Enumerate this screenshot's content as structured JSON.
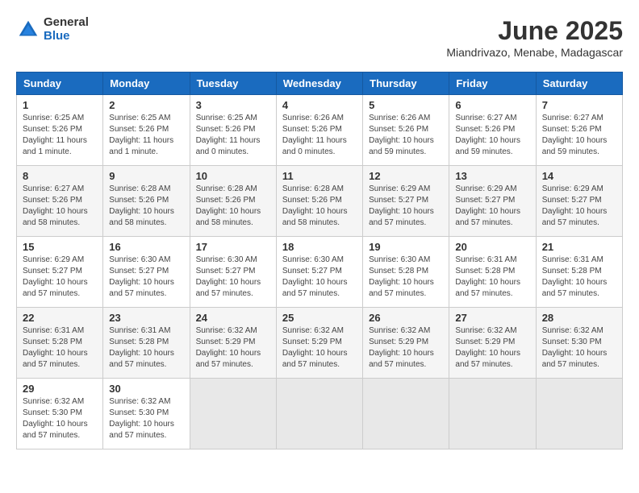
{
  "header": {
    "logo_general": "General",
    "logo_blue": "Blue",
    "month_title": "June 2025",
    "subtitle": "Miandrivazo, Menabe, Madagascar"
  },
  "days_of_week": [
    "Sunday",
    "Monday",
    "Tuesday",
    "Wednesday",
    "Thursday",
    "Friday",
    "Saturday"
  ],
  "weeks": [
    [
      {
        "day": 1,
        "info": "Sunrise: 6:25 AM\nSunset: 5:26 PM\nDaylight: 11 hours and 1 minute."
      },
      {
        "day": 2,
        "info": "Sunrise: 6:25 AM\nSunset: 5:26 PM\nDaylight: 11 hours and 1 minute."
      },
      {
        "day": 3,
        "info": "Sunrise: 6:25 AM\nSunset: 5:26 PM\nDaylight: 11 hours and 0 minutes."
      },
      {
        "day": 4,
        "info": "Sunrise: 6:26 AM\nSunset: 5:26 PM\nDaylight: 11 hours and 0 minutes."
      },
      {
        "day": 5,
        "info": "Sunrise: 6:26 AM\nSunset: 5:26 PM\nDaylight: 10 hours and 59 minutes."
      },
      {
        "day": 6,
        "info": "Sunrise: 6:27 AM\nSunset: 5:26 PM\nDaylight: 10 hours and 59 minutes."
      },
      {
        "day": 7,
        "info": "Sunrise: 6:27 AM\nSunset: 5:26 PM\nDaylight: 10 hours and 59 minutes."
      }
    ],
    [
      {
        "day": 8,
        "info": "Sunrise: 6:27 AM\nSunset: 5:26 PM\nDaylight: 10 hours and 58 minutes."
      },
      {
        "day": 9,
        "info": "Sunrise: 6:28 AM\nSunset: 5:26 PM\nDaylight: 10 hours and 58 minutes."
      },
      {
        "day": 10,
        "info": "Sunrise: 6:28 AM\nSunset: 5:26 PM\nDaylight: 10 hours and 58 minutes."
      },
      {
        "day": 11,
        "info": "Sunrise: 6:28 AM\nSunset: 5:26 PM\nDaylight: 10 hours and 58 minutes."
      },
      {
        "day": 12,
        "info": "Sunrise: 6:29 AM\nSunset: 5:27 PM\nDaylight: 10 hours and 57 minutes."
      },
      {
        "day": 13,
        "info": "Sunrise: 6:29 AM\nSunset: 5:27 PM\nDaylight: 10 hours and 57 minutes."
      },
      {
        "day": 14,
        "info": "Sunrise: 6:29 AM\nSunset: 5:27 PM\nDaylight: 10 hours and 57 minutes."
      }
    ],
    [
      {
        "day": 15,
        "info": "Sunrise: 6:29 AM\nSunset: 5:27 PM\nDaylight: 10 hours and 57 minutes."
      },
      {
        "day": 16,
        "info": "Sunrise: 6:30 AM\nSunset: 5:27 PM\nDaylight: 10 hours and 57 minutes."
      },
      {
        "day": 17,
        "info": "Sunrise: 6:30 AM\nSunset: 5:27 PM\nDaylight: 10 hours and 57 minutes."
      },
      {
        "day": 18,
        "info": "Sunrise: 6:30 AM\nSunset: 5:27 PM\nDaylight: 10 hours and 57 minutes."
      },
      {
        "day": 19,
        "info": "Sunrise: 6:30 AM\nSunset: 5:28 PM\nDaylight: 10 hours and 57 minutes."
      },
      {
        "day": 20,
        "info": "Sunrise: 6:31 AM\nSunset: 5:28 PM\nDaylight: 10 hours and 57 minutes."
      },
      {
        "day": 21,
        "info": "Sunrise: 6:31 AM\nSunset: 5:28 PM\nDaylight: 10 hours and 57 minutes."
      }
    ],
    [
      {
        "day": 22,
        "info": "Sunrise: 6:31 AM\nSunset: 5:28 PM\nDaylight: 10 hours and 57 minutes."
      },
      {
        "day": 23,
        "info": "Sunrise: 6:31 AM\nSunset: 5:28 PM\nDaylight: 10 hours and 57 minutes."
      },
      {
        "day": 24,
        "info": "Sunrise: 6:32 AM\nSunset: 5:29 PM\nDaylight: 10 hours and 57 minutes."
      },
      {
        "day": 25,
        "info": "Sunrise: 6:32 AM\nSunset: 5:29 PM\nDaylight: 10 hours and 57 minutes."
      },
      {
        "day": 26,
        "info": "Sunrise: 6:32 AM\nSunset: 5:29 PM\nDaylight: 10 hours and 57 minutes."
      },
      {
        "day": 27,
        "info": "Sunrise: 6:32 AM\nSunset: 5:29 PM\nDaylight: 10 hours and 57 minutes."
      },
      {
        "day": 28,
        "info": "Sunrise: 6:32 AM\nSunset: 5:30 PM\nDaylight: 10 hours and 57 minutes."
      }
    ],
    [
      {
        "day": 29,
        "info": "Sunrise: 6:32 AM\nSunset: 5:30 PM\nDaylight: 10 hours and 57 minutes."
      },
      {
        "day": 30,
        "info": "Sunrise: 6:32 AM\nSunset: 5:30 PM\nDaylight: 10 hours and 57 minutes."
      },
      null,
      null,
      null,
      null,
      null
    ]
  ]
}
